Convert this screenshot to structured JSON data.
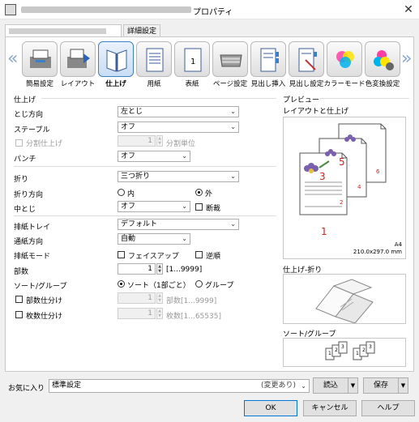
{
  "window": {
    "title": "プロパティ",
    "close_glyph": "✕"
  },
  "tabs": {
    "ps": "PS",
    "detail": "詳細設定"
  },
  "toolbar": {
    "left_arrow": "«",
    "right_arrow": "»",
    "items": [
      {
        "label": "簡易設定",
        "icon": "quick-setup-icon"
      },
      {
        "label": "レイアウト",
        "icon": "layout-icon"
      },
      {
        "label": "仕上げ",
        "icon": "finishing-icon"
      },
      {
        "label": "用紙",
        "icon": "paper-icon"
      },
      {
        "label": "表紙",
        "icon": "cover-icon"
      },
      {
        "label": "ページ設定",
        "icon": "page-setting-icon"
      },
      {
        "label": "見出し挿入",
        "icon": "tab-insert-icon"
      },
      {
        "label": "見出し設定",
        "icon": "tab-setting-icon"
      },
      {
        "label": "カラーモード",
        "icon": "color-mode-icon"
      },
      {
        "label": "色変換設定",
        "icon": "color-conversion-icon"
      }
    ],
    "selected_index": 2
  },
  "finishing": {
    "group_title": "仕上げ",
    "binding_label": "とじ方向",
    "binding_value": "左とじ",
    "staple_label": "ステープル",
    "staple_value": "オフ",
    "split_label": "分割仕上げ",
    "split_value": "1",
    "split_unit": "分割単位",
    "punch_label": "パンチ",
    "punch_value": "オフ",
    "fold_label": "折り",
    "fold_value": "三つ折り",
    "fold_dir_label": "折り方向",
    "fold_in": "内",
    "fold_out": "外",
    "saddle_label": "中とじ",
    "saddle_value": "オフ",
    "trim_label": "断裁",
    "tray_label": "排紙トレイ",
    "tray_value": "デフォルト",
    "feed_label": "通紙方向",
    "feed_value": "自動",
    "output_mode_label": "排紙モード",
    "face_up": "フェイスアップ",
    "reverse": "逆順",
    "copies_label": "部数",
    "copies_value": "1",
    "copies_range": "[1...9999]",
    "sort_label": "ソート/グループ",
    "sort_option": "ソート（1部ごと）",
    "group_option": "グループ",
    "copy_sep_label": "部数仕分け",
    "copy_sep_value": "1",
    "copy_sep_range": "部数[1...9999]",
    "sheet_sep_label": "枚数仕分け",
    "sheet_sep_value": "1",
    "sheet_sep_range": "枚数[1...65535]"
  },
  "preview": {
    "group_title": "プレビュー",
    "layout_title": "レイアウトと仕上げ",
    "page_numbers": [
      "5",
      "3",
      "1"
    ],
    "side_numbers": [
      "6",
      "4",
      "2"
    ],
    "paper_size": "A4",
    "paper_dims": "210.0x297.0 mm",
    "fold_title": "仕上げ-折り",
    "sort_title": "ソート/グループ",
    "sort_digits": [
      "1",
      "2",
      "3"
    ]
  },
  "favorites": {
    "label": "お気に入り",
    "value": "標準設定",
    "changed": "(変更あり)",
    "load": "読込",
    "save": "保存"
  },
  "buttons": {
    "ok": "OK",
    "cancel": "キャンセル",
    "help": "ヘルプ"
  },
  "colors": {
    "accent": "#3c7fc9",
    "page_number": "#d02020",
    "flower": "#7a5fb0"
  }
}
